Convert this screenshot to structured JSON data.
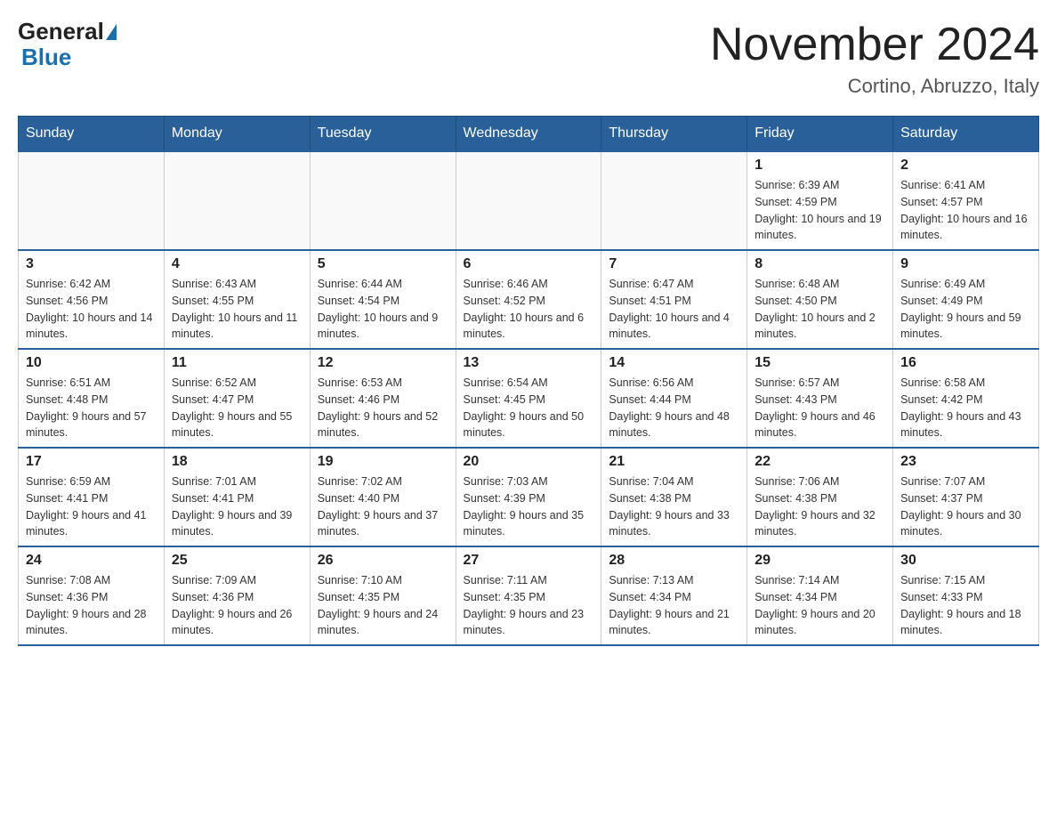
{
  "header": {
    "logo": {
      "general": "General",
      "blue": "Blue"
    },
    "title": "November 2024",
    "location": "Cortino, Abruzzo, Italy"
  },
  "weekdays": [
    "Sunday",
    "Monday",
    "Tuesday",
    "Wednesday",
    "Thursday",
    "Friday",
    "Saturday"
  ],
  "weeks": [
    [
      {
        "day": "",
        "sunrise": "",
        "sunset": "",
        "daylight": ""
      },
      {
        "day": "",
        "sunrise": "",
        "sunset": "",
        "daylight": ""
      },
      {
        "day": "",
        "sunrise": "",
        "sunset": "",
        "daylight": ""
      },
      {
        "day": "",
        "sunrise": "",
        "sunset": "",
        "daylight": ""
      },
      {
        "day": "",
        "sunrise": "",
        "sunset": "",
        "daylight": ""
      },
      {
        "day": "1",
        "sunrise": "Sunrise: 6:39 AM",
        "sunset": "Sunset: 4:59 PM",
        "daylight": "Daylight: 10 hours and 19 minutes."
      },
      {
        "day": "2",
        "sunrise": "Sunrise: 6:41 AM",
        "sunset": "Sunset: 4:57 PM",
        "daylight": "Daylight: 10 hours and 16 minutes."
      }
    ],
    [
      {
        "day": "3",
        "sunrise": "Sunrise: 6:42 AM",
        "sunset": "Sunset: 4:56 PM",
        "daylight": "Daylight: 10 hours and 14 minutes."
      },
      {
        "day": "4",
        "sunrise": "Sunrise: 6:43 AM",
        "sunset": "Sunset: 4:55 PM",
        "daylight": "Daylight: 10 hours and 11 minutes."
      },
      {
        "day": "5",
        "sunrise": "Sunrise: 6:44 AM",
        "sunset": "Sunset: 4:54 PM",
        "daylight": "Daylight: 10 hours and 9 minutes."
      },
      {
        "day": "6",
        "sunrise": "Sunrise: 6:46 AM",
        "sunset": "Sunset: 4:52 PM",
        "daylight": "Daylight: 10 hours and 6 minutes."
      },
      {
        "day": "7",
        "sunrise": "Sunrise: 6:47 AM",
        "sunset": "Sunset: 4:51 PM",
        "daylight": "Daylight: 10 hours and 4 minutes."
      },
      {
        "day": "8",
        "sunrise": "Sunrise: 6:48 AM",
        "sunset": "Sunset: 4:50 PM",
        "daylight": "Daylight: 10 hours and 2 minutes."
      },
      {
        "day": "9",
        "sunrise": "Sunrise: 6:49 AM",
        "sunset": "Sunset: 4:49 PM",
        "daylight": "Daylight: 9 hours and 59 minutes."
      }
    ],
    [
      {
        "day": "10",
        "sunrise": "Sunrise: 6:51 AM",
        "sunset": "Sunset: 4:48 PM",
        "daylight": "Daylight: 9 hours and 57 minutes."
      },
      {
        "day": "11",
        "sunrise": "Sunrise: 6:52 AM",
        "sunset": "Sunset: 4:47 PM",
        "daylight": "Daylight: 9 hours and 55 minutes."
      },
      {
        "day": "12",
        "sunrise": "Sunrise: 6:53 AM",
        "sunset": "Sunset: 4:46 PM",
        "daylight": "Daylight: 9 hours and 52 minutes."
      },
      {
        "day": "13",
        "sunrise": "Sunrise: 6:54 AM",
        "sunset": "Sunset: 4:45 PM",
        "daylight": "Daylight: 9 hours and 50 minutes."
      },
      {
        "day": "14",
        "sunrise": "Sunrise: 6:56 AM",
        "sunset": "Sunset: 4:44 PM",
        "daylight": "Daylight: 9 hours and 48 minutes."
      },
      {
        "day": "15",
        "sunrise": "Sunrise: 6:57 AM",
        "sunset": "Sunset: 4:43 PM",
        "daylight": "Daylight: 9 hours and 46 minutes."
      },
      {
        "day": "16",
        "sunrise": "Sunrise: 6:58 AM",
        "sunset": "Sunset: 4:42 PM",
        "daylight": "Daylight: 9 hours and 43 minutes."
      }
    ],
    [
      {
        "day": "17",
        "sunrise": "Sunrise: 6:59 AM",
        "sunset": "Sunset: 4:41 PM",
        "daylight": "Daylight: 9 hours and 41 minutes."
      },
      {
        "day": "18",
        "sunrise": "Sunrise: 7:01 AM",
        "sunset": "Sunset: 4:41 PM",
        "daylight": "Daylight: 9 hours and 39 minutes."
      },
      {
        "day": "19",
        "sunrise": "Sunrise: 7:02 AM",
        "sunset": "Sunset: 4:40 PM",
        "daylight": "Daylight: 9 hours and 37 minutes."
      },
      {
        "day": "20",
        "sunrise": "Sunrise: 7:03 AM",
        "sunset": "Sunset: 4:39 PM",
        "daylight": "Daylight: 9 hours and 35 minutes."
      },
      {
        "day": "21",
        "sunrise": "Sunrise: 7:04 AM",
        "sunset": "Sunset: 4:38 PM",
        "daylight": "Daylight: 9 hours and 33 minutes."
      },
      {
        "day": "22",
        "sunrise": "Sunrise: 7:06 AM",
        "sunset": "Sunset: 4:38 PM",
        "daylight": "Daylight: 9 hours and 32 minutes."
      },
      {
        "day": "23",
        "sunrise": "Sunrise: 7:07 AM",
        "sunset": "Sunset: 4:37 PM",
        "daylight": "Daylight: 9 hours and 30 minutes."
      }
    ],
    [
      {
        "day": "24",
        "sunrise": "Sunrise: 7:08 AM",
        "sunset": "Sunset: 4:36 PM",
        "daylight": "Daylight: 9 hours and 28 minutes."
      },
      {
        "day": "25",
        "sunrise": "Sunrise: 7:09 AM",
        "sunset": "Sunset: 4:36 PM",
        "daylight": "Daylight: 9 hours and 26 minutes."
      },
      {
        "day": "26",
        "sunrise": "Sunrise: 7:10 AM",
        "sunset": "Sunset: 4:35 PM",
        "daylight": "Daylight: 9 hours and 24 minutes."
      },
      {
        "day": "27",
        "sunrise": "Sunrise: 7:11 AM",
        "sunset": "Sunset: 4:35 PM",
        "daylight": "Daylight: 9 hours and 23 minutes."
      },
      {
        "day": "28",
        "sunrise": "Sunrise: 7:13 AM",
        "sunset": "Sunset: 4:34 PM",
        "daylight": "Daylight: 9 hours and 21 minutes."
      },
      {
        "day": "29",
        "sunrise": "Sunrise: 7:14 AM",
        "sunset": "Sunset: 4:34 PM",
        "daylight": "Daylight: 9 hours and 20 minutes."
      },
      {
        "day": "30",
        "sunrise": "Sunrise: 7:15 AM",
        "sunset": "Sunset: 4:33 PM",
        "daylight": "Daylight: 9 hours and 18 minutes."
      }
    ]
  ]
}
